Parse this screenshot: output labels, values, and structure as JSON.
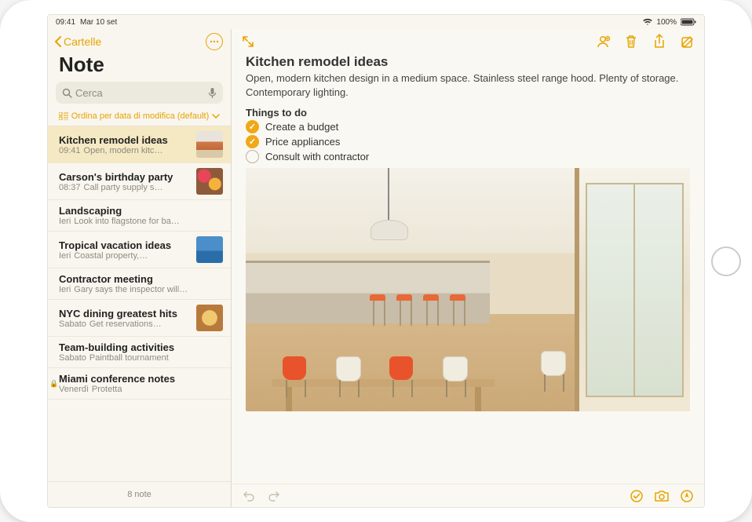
{
  "statusbar": {
    "time": "09:41",
    "date": "Mar 10 set",
    "battery": "100%"
  },
  "sidebar": {
    "back_label": "Cartelle",
    "title": "Note",
    "search_placeholder": "Cerca",
    "sort_label": "Ordina per data di modifica (default)",
    "footer": "8 note",
    "items": [
      {
        "title": "Kitchen remodel ideas",
        "time": "09:41",
        "preview": "Open, modern kitc…",
        "thumb": "kitchen",
        "selected": true
      },
      {
        "title": "Carson's birthday party",
        "time": "08:37",
        "preview": "Call party supply s…",
        "thumb": "party"
      },
      {
        "title": "Landscaping",
        "time": "Ieri",
        "preview": "Look into flagstone for ba…",
        "thumb": null
      },
      {
        "title": "Tropical vacation ideas",
        "time": "Ieri",
        "preview": "Coastal property,…",
        "thumb": "tropical"
      },
      {
        "title": "Contractor meeting",
        "time": "Ieri",
        "preview": "Gary says the inspector will…",
        "thumb": null
      },
      {
        "title": "NYC dining greatest hits",
        "time": "Sabato",
        "preview": "Get reservations…",
        "thumb": "food"
      },
      {
        "title": "Team-building activities",
        "time": "Sabato",
        "preview": "Paintball tournament",
        "thumb": null
      },
      {
        "title": "Miami conference notes",
        "time": "Venerdì",
        "preview": "Protetta",
        "thumb": null,
        "locked": true
      }
    ]
  },
  "note": {
    "title": "Kitchen remodel ideas",
    "body": "Open, modern kitchen design in a medium space. Stainless steel range hood. Plenty of storage. Contemporary lighting.",
    "section": "Things to do",
    "todos": [
      {
        "text": "Create a budget",
        "checked": true
      },
      {
        "text": "Price appliances",
        "checked": true
      },
      {
        "text": "Consult with contractor",
        "checked": false
      }
    ]
  }
}
